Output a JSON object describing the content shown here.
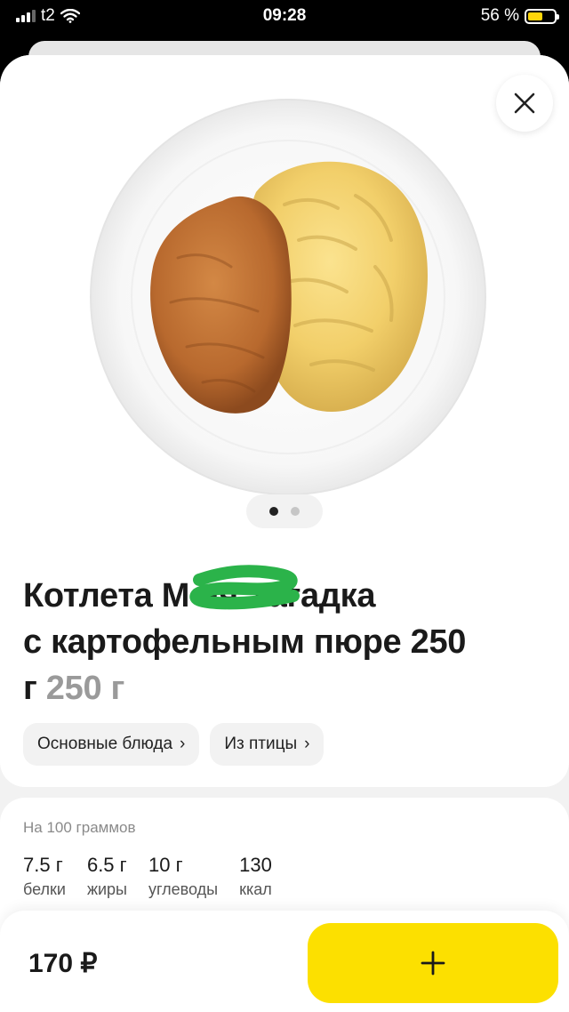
{
  "status_bar": {
    "carrier": "t2",
    "time": "09:28",
    "battery_text": "56 %",
    "battery_level": 0.56,
    "battery_color": "#ffd60a"
  },
  "icons": {
    "close": "close-icon",
    "plus": "plus-icon",
    "wifi": "wifi-icon",
    "signal": "signal-icon",
    "battery": "battery-icon",
    "chevron": "chevron-right-icon"
  },
  "product": {
    "image_alt": "cutlet-with-mashed-potatoes-photo",
    "carousel": {
      "total": 2,
      "active": 1
    },
    "title_line1": "Котлета М   ня Загадка",
    "title_line2": "с картофельным пюре 250",
    "title_line3": "г",
    "weight": "250 г",
    "categories": [
      {
        "label": "Основные блюда",
        "chevron": "›"
      },
      {
        "label": "Из птицы",
        "chevron": "›"
      }
    ]
  },
  "nutrition": {
    "header": "На 100 граммов",
    "items": [
      {
        "value": "7.5 г",
        "label": "белки"
      },
      {
        "value": "6.5 г",
        "label": "жиры"
      },
      {
        "value": "10 г",
        "label": "углеводы"
      },
      {
        "value": "130",
        "label": "ккал"
      }
    ]
  },
  "footer": {
    "price": "170 ₽",
    "accent_color": "#fce000"
  }
}
